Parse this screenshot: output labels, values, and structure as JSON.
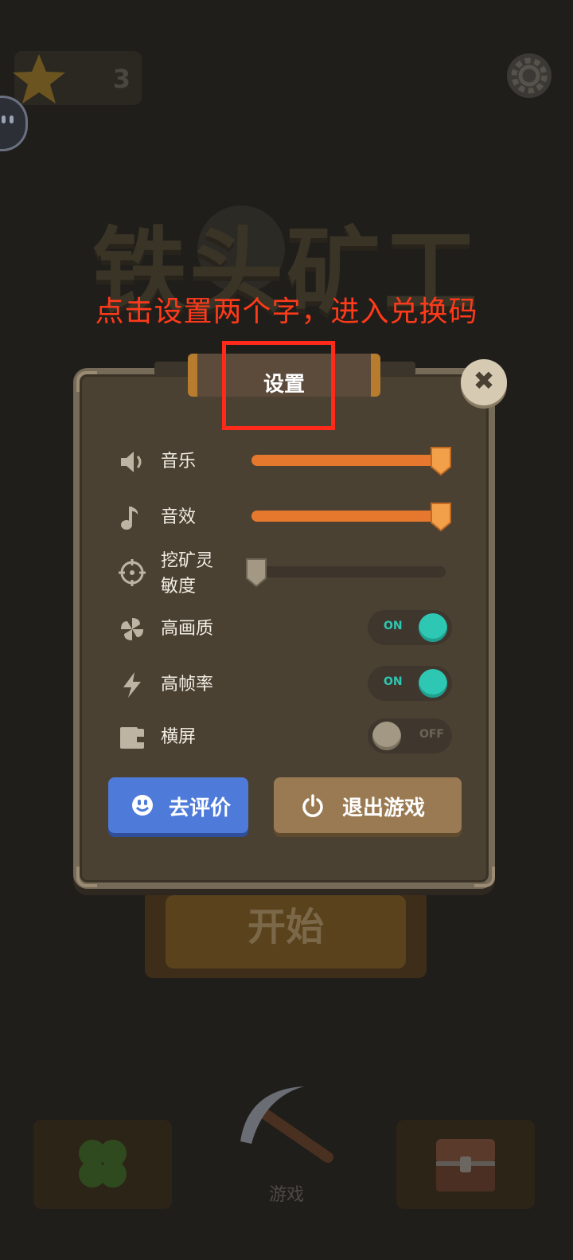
{
  "hud": {
    "star_count": "3",
    "gear_icon": "gear-icon",
    "star_icon": "star-icon"
  },
  "game": {
    "title": "铁头矿工",
    "start_label": "开始",
    "tab_game_label": "游戏"
  },
  "annotation": {
    "text": "点击设置两个字，进入兑换码",
    "color": "#ff3a1a"
  },
  "dialog": {
    "title": "设置",
    "close_icon": "close-icon",
    "settings": {
      "music": {
        "label": "音乐",
        "icon": "speaker-icon",
        "level": 0.95
      },
      "sound": {
        "label": "音效",
        "icon": "music-note-icon",
        "level": 0.95
      },
      "sensitivity": {
        "label_line1": "挖矿灵",
        "label_line2": "敏度",
        "icon": "crosshair-icon",
        "level": 0.0
      },
      "quality": {
        "label": "高画质",
        "icon": "pinwheel-icon",
        "state": "ON"
      },
      "framerate": {
        "label": "高帧率",
        "icon": "lightning-icon",
        "state": "ON"
      },
      "landscape": {
        "label": "横屏",
        "icon": "wallet-icon",
        "state": "OFF"
      }
    },
    "buttons": {
      "rate": {
        "label": "去评价",
        "icon": "smiley-icon",
        "color": "#4e7ad9"
      },
      "exit": {
        "label": "退出游戏",
        "icon": "power-icon",
        "color": "#9a7a52"
      }
    }
  },
  "colors": {
    "slider_fill": "#e6782d",
    "toggle_on": "#2ec7b3"
  }
}
